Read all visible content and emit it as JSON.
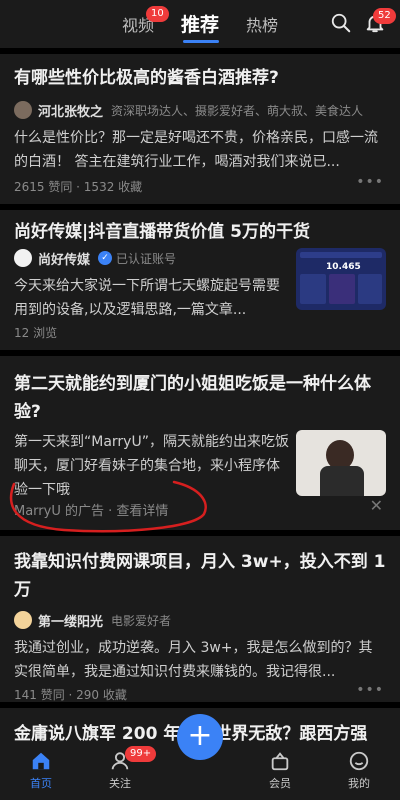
{
  "header": {
    "tabs": [
      {
        "label": "视频",
        "badge": "10"
      },
      {
        "label": "推荐"
      },
      {
        "label": "热榜"
      }
    ],
    "notification_badge": "52"
  },
  "feed": [
    {
      "title": "有哪些性价比极高的酱香白酒推荐?",
      "author": "河北张牧之",
      "tags": "资深职场达人、摄影爱好者、萌大叔、美食达人",
      "excerpt": "什么是性价比？那一定是好喝还不贵，价格亲民，口感一流的白酒！ 答主在建筑行业工作，喝酒对我们来说已...",
      "stats": "2615 赞同 · 1532 收藏"
    },
    {
      "title": "尚好传媒|抖音直播带货价值 5万的干货",
      "author": "尚好传媒",
      "tags": "已认证账号",
      "excerpt": "今天来给大家说一下所谓七天螺旋起号需要用到的设备,以及逻辑思路,一篇文章...",
      "stats": "12 浏览",
      "thumb_text": "10.465"
    },
    {
      "title": "第二天就能约到厦门的小姐姐吃饭是一种什么体验?",
      "excerpt": "第一天来到“MarryU”，隔天就能约出来吃饭聊天，厦门好看妹子的集合地，来小程序体验一下哦",
      "ad_label": "MarryU 的广告 · 查看详情"
    },
    {
      "title": "我靠知识付费网课项目，月入 3w+，投入不到 1 万",
      "author": "第一缕阳光",
      "tags": "电影爱好者",
      "excerpt": "我通过创业，成功逆袭。月入 3w+，我是怎么做到的？其实很简单，我是通过知识付费来赚钱的。我记得很...",
      "stats": "141 赞同 · 290 收藏"
    },
    {
      "title": "金庸说八旗军 200 年内全世界无敌？跟西方强"
    }
  ],
  "bottom_nav": [
    {
      "label": "首页"
    },
    {
      "label": "关注",
      "badge": "99+"
    },
    {
      "label": "会员"
    },
    {
      "label": "我的"
    }
  ],
  "colors": {
    "accent": "#3b82f6",
    "badge": "#ef3b3b",
    "annotation": "#d61f1f"
  }
}
